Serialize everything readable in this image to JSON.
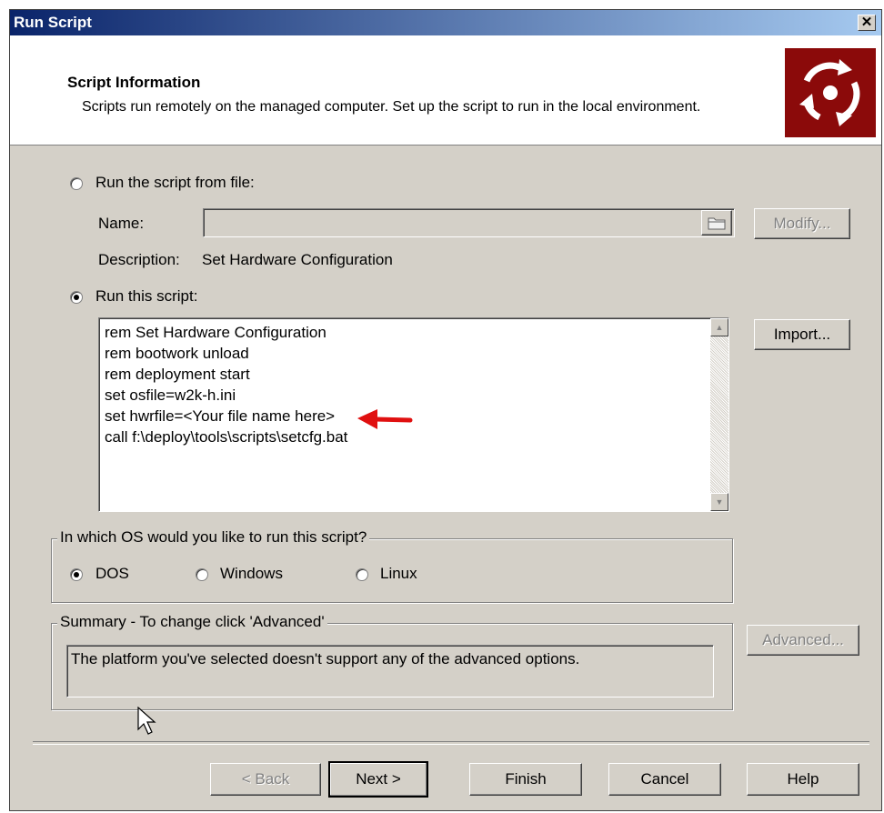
{
  "window": {
    "title": "Run Script",
    "close_label": "✕"
  },
  "header": {
    "title": "Script Information",
    "description": "Scripts run remotely on the managed computer. Set up the script to run in the local environment."
  },
  "source": {
    "from_file_label": "Run the script from file:",
    "name_label": "Name:",
    "name_value": "",
    "modify_label": "Modify...",
    "description_label": "Description:",
    "description_value": "Set Hardware Configuration",
    "this_script_label": "Run this script:",
    "import_label": "Import...",
    "selected": "this_script"
  },
  "script": {
    "lines": [
      "rem Set Hardware Configuration",
      "rem bootwork unload",
      "rem deployment start",
      "set osfile=w2k-h.ini",
      "set hwrfile=<Your file name here>",
      "call f:\\deploy\\tools\\scripts\\setcfg.bat"
    ]
  },
  "os": {
    "legend": "In which OS would you like to run this script?",
    "options": [
      "DOS",
      "Windows",
      "Linux"
    ],
    "selected": "DOS"
  },
  "summary": {
    "legend": "Summary - To change click 'Advanced'",
    "text": "The platform you've selected doesn't support any of the advanced options.",
    "advanced_label": "Advanced..."
  },
  "footer": {
    "back_label": "< Back",
    "next_label": "Next >",
    "finish_label": "Finish",
    "cancel_label": "Cancel",
    "help_label": "Help"
  },
  "colors": {
    "accent": "#8b0a0a",
    "annotation_arrow": "#e01010"
  }
}
